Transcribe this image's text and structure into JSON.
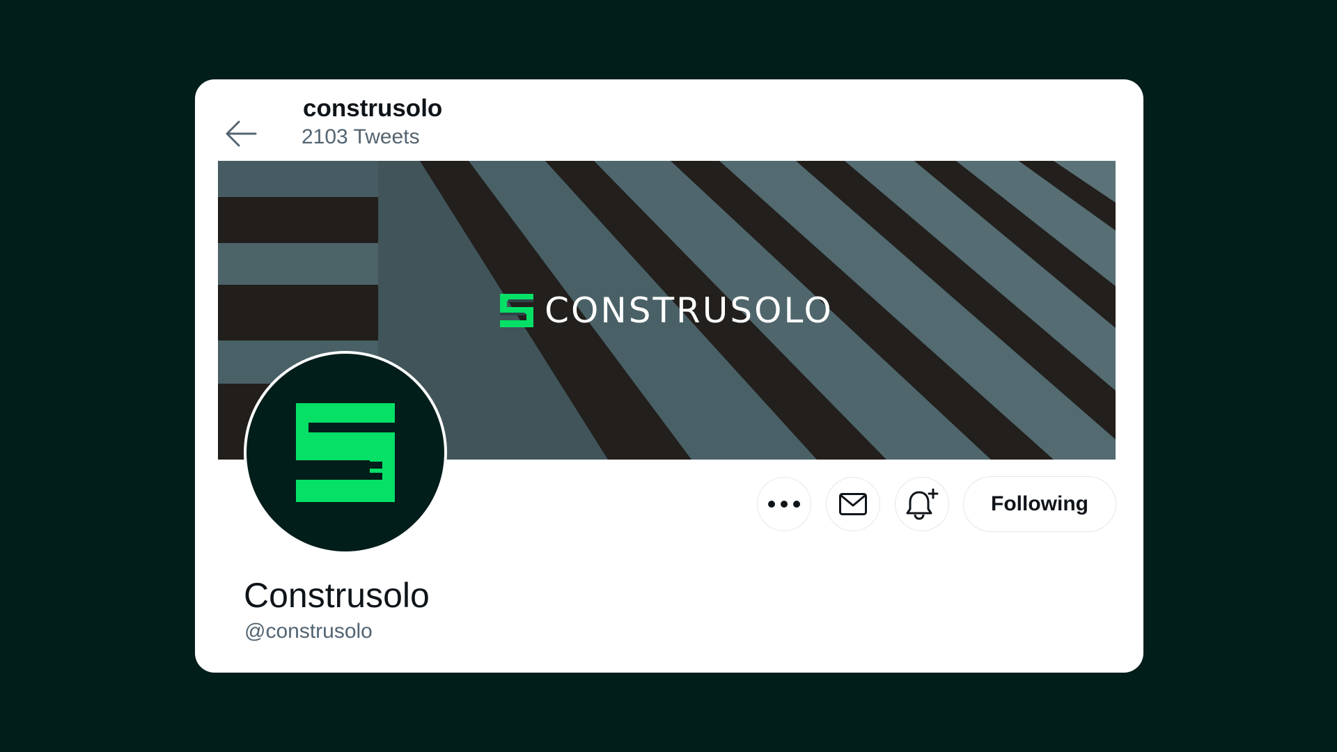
{
  "header": {
    "name": "construsolo",
    "tweet_count": "2103 Tweets"
  },
  "banner": {
    "wordmark": "CONSTRUSOLO"
  },
  "profile": {
    "display_name": "Construsolo",
    "handle": "@construsolo"
  },
  "actions": {
    "more_icon": "more-dots-icon",
    "message_icon": "mail-icon",
    "notify_icon": "bell-plus-icon",
    "follow_label": "Following"
  },
  "colors": {
    "page_background": "#021e1b",
    "brand_green": "#06e067",
    "text_primary": "#0f1419",
    "text_secondary": "#536471"
  }
}
